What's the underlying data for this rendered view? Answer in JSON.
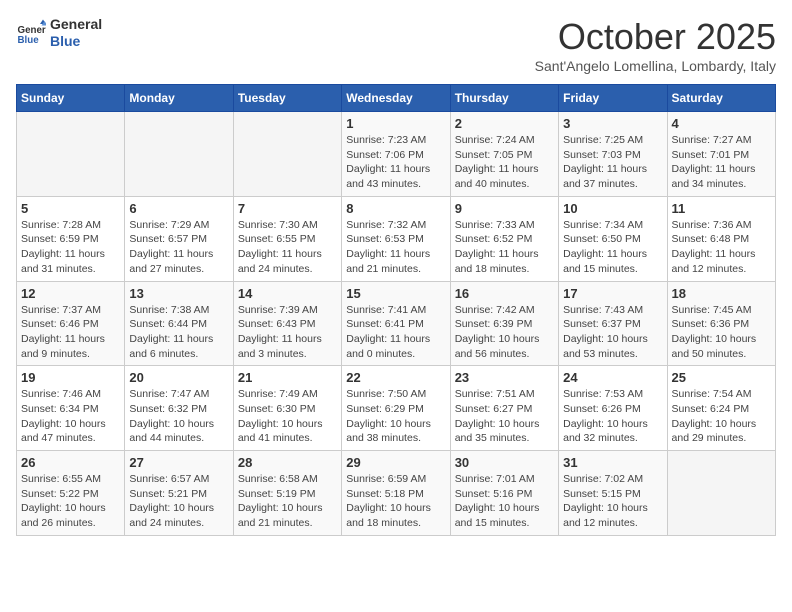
{
  "header": {
    "logo_line1": "General",
    "logo_line2": "Blue",
    "month": "October 2025",
    "location": "Sant'Angelo Lomellina, Lombardy, Italy"
  },
  "weekdays": [
    "Sunday",
    "Monday",
    "Tuesday",
    "Wednesday",
    "Thursday",
    "Friday",
    "Saturday"
  ],
  "weeks": [
    [
      {
        "day": "",
        "data": ""
      },
      {
        "day": "",
        "data": ""
      },
      {
        "day": "",
        "data": ""
      },
      {
        "day": "1",
        "data": "Sunrise: 7:23 AM\nSunset: 7:06 PM\nDaylight: 11 hours\nand 43 minutes."
      },
      {
        "day": "2",
        "data": "Sunrise: 7:24 AM\nSunset: 7:05 PM\nDaylight: 11 hours\nand 40 minutes."
      },
      {
        "day": "3",
        "data": "Sunrise: 7:25 AM\nSunset: 7:03 PM\nDaylight: 11 hours\nand 37 minutes."
      },
      {
        "day": "4",
        "data": "Sunrise: 7:27 AM\nSunset: 7:01 PM\nDaylight: 11 hours\nand 34 minutes."
      }
    ],
    [
      {
        "day": "5",
        "data": "Sunrise: 7:28 AM\nSunset: 6:59 PM\nDaylight: 11 hours\nand 31 minutes."
      },
      {
        "day": "6",
        "data": "Sunrise: 7:29 AM\nSunset: 6:57 PM\nDaylight: 11 hours\nand 27 minutes."
      },
      {
        "day": "7",
        "data": "Sunrise: 7:30 AM\nSunset: 6:55 PM\nDaylight: 11 hours\nand 24 minutes."
      },
      {
        "day": "8",
        "data": "Sunrise: 7:32 AM\nSunset: 6:53 PM\nDaylight: 11 hours\nand 21 minutes."
      },
      {
        "day": "9",
        "data": "Sunrise: 7:33 AM\nSunset: 6:52 PM\nDaylight: 11 hours\nand 18 minutes."
      },
      {
        "day": "10",
        "data": "Sunrise: 7:34 AM\nSunset: 6:50 PM\nDaylight: 11 hours\nand 15 minutes."
      },
      {
        "day": "11",
        "data": "Sunrise: 7:36 AM\nSunset: 6:48 PM\nDaylight: 11 hours\nand 12 minutes."
      }
    ],
    [
      {
        "day": "12",
        "data": "Sunrise: 7:37 AM\nSunset: 6:46 PM\nDaylight: 11 hours\nand 9 minutes."
      },
      {
        "day": "13",
        "data": "Sunrise: 7:38 AM\nSunset: 6:44 PM\nDaylight: 11 hours\nand 6 minutes."
      },
      {
        "day": "14",
        "data": "Sunrise: 7:39 AM\nSunset: 6:43 PM\nDaylight: 11 hours\nand 3 minutes."
      },
      {
        "day": "15",
        "data": "Sunrise: 7:41 AM\nSunset: 6:41 PM\nDaylight: 11 hours\nand 0 minutes."
      },
      {
        "day": "16",
        "data": "Sunrise: 7:42 AM\nSunset: 6:39 PM\nDaylight: 10 hours\nand 56 minutes."
      },
      {
        "day": "17",
        "data": "Sunrise: 7:43 AM\nSunset: 6:37 PM\nDaylight: 10 hours\nand 53 minutes."
      },
      {
        "day": "18",
        "data": "Sunrise: 7:45 AM\nSunset: 6:36 PM\nDaylight: 10 hours\nand 50 minutes."
      }
    ],
    [
      {
        "day": "19",
        "data": "Sunrise: 7:46 AM\nSunset: 6:34 PM\nDaylight: 10 hours\nand 47 minutes."
      },
      {
        "day": "20",
        "data": "Sunrise: 7:47 AM\nSunset: 6:32 PM\nDaylight: 10 hours\nand 44 minutes."
      },
      {
        "day": "21",
        "data": "Sunrise: 7:49 AM\nSunset: 6:30 PM\nDaylight: 10 hours\nand 41 minutes."
      },
      {
        "day": "22",
        "data": "Sunrise: 7:50 AM\nSunset: 6:29 PM\nDaylight: 10 hours\nand 38 minutes."
      },
      {
        "day": "23",
        "data": "Sunrise: 7:51 AM\nSunset: 6:27 PM\nDaylight: 10 hours\nand 35 minutes."
      },
      {
        "day": "24",
        "data": "Sunrise: 7:53 AM\nSunset: 6:26 PM\nDaylight: 10 hours\nand 32 minutes."
      },
      {
        "day": "25",
        "data": "Sunrise: 7:54 AM\nSunset: 6:24 PM\nDaylight: 10 hours\nand 29 minutes."
      }
    ],
    [
      {
        "day": "26",
        "data": "Sunrise: 6:55 AM\nSunset: 5:22 PM\nDaylight: 10 hours\nand 26 minutes."
      },
      {
        "day": "27",
        "data": "Sunrise: 6:57 AM\nSunset: 5:21 PM\nDaylight: 10 hours\nand 24 minutes."
      },
      {
        "day": "28",
        "data": "Sunrise: 6:58 AM\nSunset: 5:19 PM\nDaylight: 10 hours\nand 21 minutes."
      },
      {
        "day": "29",
        "data": "Sunrise: 6:59 AM\nSunset: 5:18 PM\nDaylight: 10 hours\nand 18 minutes."
      },
      {
        "day": "30",
        "data": "Sunrise: 7:01 AM\nSunset: 5:16 PM\nDaylight: 10 hours\nand 15 minutes."
      },
      {
        "day": "31",
        "data": "Sunrise: 7:02 AM\nSunset: 5:15 PM\nDaylight: 10 hours\nand 12 minutes."
      },
      {
        "day": "",
        "data": ""
      }
    ]
  ]
}
